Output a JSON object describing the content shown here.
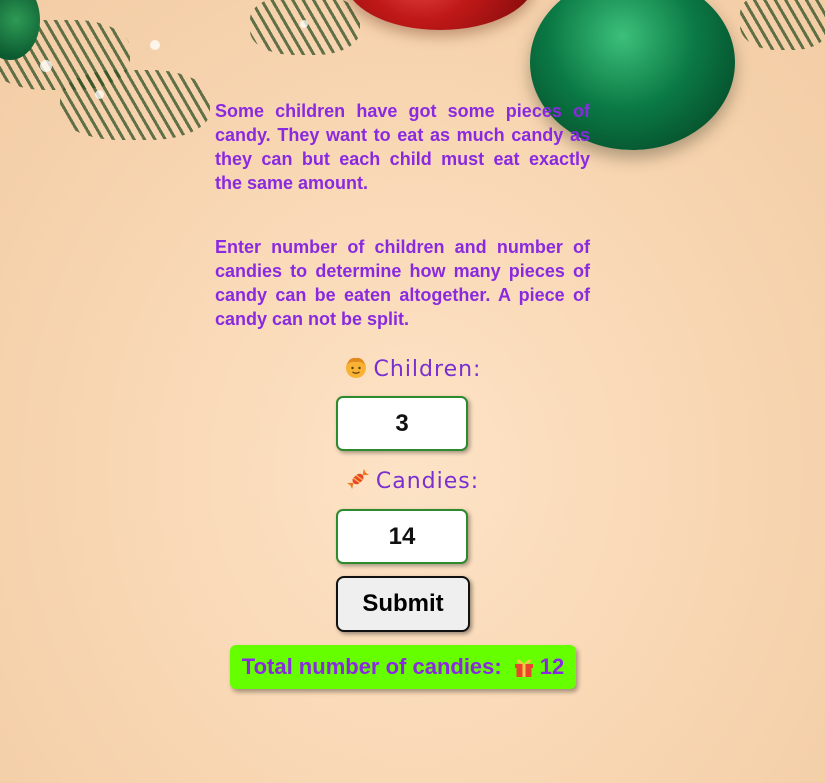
{
  "intro": {
    "paragraph1": "Some children have got some pieces of candy. They want to eat as much candy as they can but each child must eat exactly the same amount.",
    "paragraph2": "Enter number of children and number of candies to determine how many pieces of candy can be eaten altogether. A piece of candy can not be split."
  },
  "form": {
    "children_label": "Children:",
    "children_icon": "child-face-icon",
    "children_value": "3",
    "candies_label": "Candies:",
    "candies_icon": "candy-icon",
    "candies_value": "14",
    "submit_label": "Submit"
  },
  "result": {
    "label": "Total number of candies:",
    "icon": "gift-icon",
    "value": "12",
    "background_color": "#66ff00"
  },
  "colors": {
    "text_purple": "#8a2ae0",
    "input_border": "#2d8a2d"
  }
}
